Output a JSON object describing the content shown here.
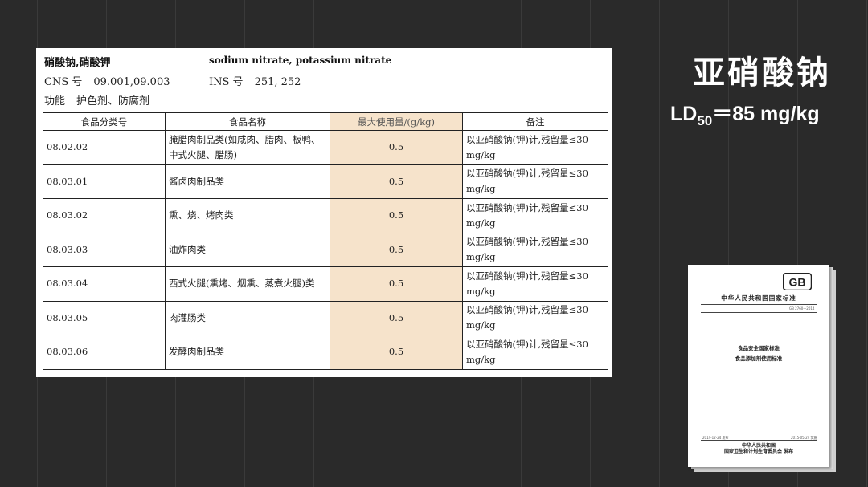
{
  "document": {
    "name_cn": "硝酸钠,硝酸钾",
    "name_en": "sodium nitrate, potassium nitrate",
    "cns_label": "CNS 号",
    "cns_value": "09.001,09.003",
    "ins_label": "INS 号",
    "ins_value": "251, 252",
    "function_label": "功能",
    "function_value": "护色剂、防腐剂"
  },
  "table": {
    "headers": [
      "食品分类号",
      "食品名称",
      "最大使用量/(g/kg)",
      "备注"
    ],
    "rows": [
      {
        "code": "08.02.02",
        "name": "腌腊肉制品类(如咸肉、腊肉、板鸭、中式火腿、腊肠)",
        "max": "0.5",
        "note": "以亚硝酸钠(钾)计,残留量≤30 mg/kg"
      },
      {
        "code": "08.03.01",
        "name": "酱卤肉制品类",
        "max": "0.5",
        "note": "以亚硝酸钠(钾)计,残留量≤30 mg/kg"
      },
      {
        "code": "08.03.02",
        "name": "熏、烧、烤肉类",
        "max": "0.5",
        "note": "以亚硝酸钠(钾)计,残留量≤30 mg/kg"
      },
      {
        "code": "08.03.03",
        "name": "油炸肉类",
        "max": "0.5",
        "note": "以亚硝酸钠(钾)计,残留量≤30 mg/kg"
      },
      {
        "code": "08.03.04",
        "name": "西式火腿(熏烤、烟熏、蒸煮火腿)类",
        "max": "0.5",
        "note": "以亚硝酸钠(钾)计,残留量≤30 mg/kg"
      },
      {
        "code": "08.03.05",
        "name": "肉灌肠类",
        "max": "0.5",
        "note": "以亚硝酸钠(钾)计,残留量≤30 mg/kg"
      },
      {
        "code": "08.03.06",
        "name": "发酵肉制品类",
        "max": "0.5",
        "note": "以亚硝酸钠(钾)计,残留量≤30 mg/kg"
      }
    ]
  },
  "side": {
    "title": "亚硝酸钠",
    "ld_prefix": "LD",
    "ld_sub": "50",
    "ld_value": "＝85 mg/kg"
  },
  "book": {
    "logo": "GB",
    "org": "中华人民共和国国家标准",
    "code": "GB 2760—2014",
    "title1": "食品安全国家标准",
    "title2": "食品添加剂使用标准",
    "issue_date": "2014-12-24 发布",
    "effective_date": "2015-05-24 实施",
    "publisher_line1": "中华人民共和国",
    "publisher_line2": "国家卫生和计划生育委员会 发布"
  },
  "colors": {
    "background": "#2a2a2a",
    "highlight_column": "#f6e3cb"
  }
}
